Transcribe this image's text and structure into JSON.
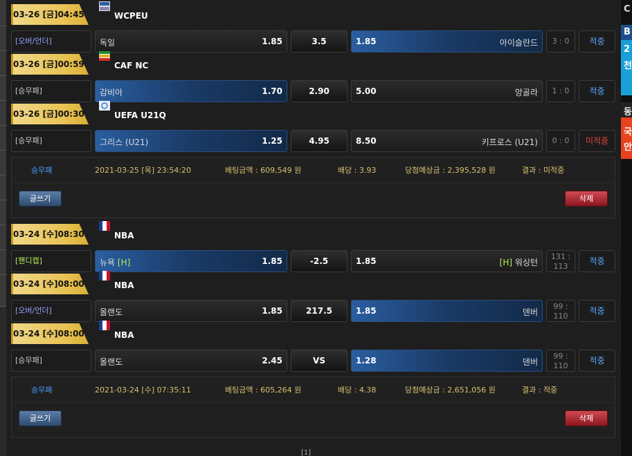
{
  "slips": [
    {
      "matches": [
        {
          "time": "03-26 [금]04:45",
          "league": "WCPEU",
          "icon": "wcpeu-league-icon",
          "type": "[오버/언더]",
          "type_style": "ou",
          "home": "독일",
          "home_odds": "1.85",
          "mid": "3.5",
          "away_odds": "1.85",
          "away": "아이슬란드",
          "home_tag": "",
          "away_tag": "",
          "score": "3 : 0",
          "score_lines": [
            "3 : 0"
          ],
          "result": "적중",
          "selected": "away"
        },
        {
          "time": "03-26 [금]00:59",
          "league": "CAF NC",
          "icon": "caf-league-icon",
          "type": "[승무패]",
          "type_style": "plain",
          "home": "감비아",
          "home_odds": "1.70",
          "mid": "2.90",
          "away_odds": "5.00",
          "away": "앙골라",
          "home_tag": "",
          "away_tag": "",
          "score": "1 : 0",
          "score_lines": [
            "1 : 0"
          ],
          "result": "적중",
          "selected": "home"
        },
        {
          "time": "03-26 [금]00:30",
          "league": "UEFA U21Q",
          "icon": "uefa-league-icon",
          "type": "[승무패]",
          "type_style": "plain",
          "home": "그리스 (U21)",
          "home_odds": "1.25",
          "mid": "4.95",
          "away_odds": "8.50",
          "away": "키프로스 (U21)",
          "home_tag": "",
          "away_tag": "",
          "score": "0 : 0",
          "score_lines": [
            "0 : 0"
          ],
          "result": "미적중",
          "selected": "home"
        }
      ],
      "summary": {
        "kind": "승무패",
        "date": "2021-03-25 [목] 23:54:20",
        "amount": "베팅금액 : 609,549 원",
        "odds": "배당 : 3.93",
        "expected": "당첨예상금 : 2,395,528 원",
        "result": "결과 : 미적중"
      },
      "write_label": "글쓰기",
      "delete_label": "삭제"
    },
    {
      "matches": [
        {
          "time": "03-24 [수]08:30",
          "league": "NBA",
          "icon": "nba-league-icon",
          "type": "[핸디캡]",
          "type_style": "hcap",
          "home": "뉴욕",
          "home_tag": "[H]",
          "home_odds": "1.85",
          "mid": "-2.5",
          "away_odds": "1.85",
          "away": "워싱턴",
          "away_tag": "[H]",
          "score": "131 : 113",
          "score_lines": [
            "131 :",
            "113"
          ],
          "result": "적중",
          "selected": "home"
        },
        {
          "time": "03-24 [수]08:00",
          "league": "NBA",
          "icon": "nba-league-icon",
          "type": "[오버/언더]",
          "type_style": "ou",
          "home": "올랜도",
          "home_odds": "1.85",
          "mid": "217.5",
          "away_odds": "1.85",
          "away": "덴버",
          "home_tag": "",
          "away_tag": "",
          "score": "99 : 110",
          "score_lines": [
            "99 :",
            "110"
          ],
          "result": "적중",
          "selected": "away"
        },
        {
          "time": "03-24 [수]08:00",
          "league": "NBA",
          "icon": "nba-league-icon",
          "type": "[승무패]",
          "type_style": "plain",
          "home": "올랜도",
          "home_odds": "2.45",
          "mid": "VS",
          "away_odds": "1.28",
          "away": "덴버",
          "home_tag": "",
          "away_tag": "",
          "score": "99 : 110",
          "score_lines": [
            "99 :",
            "110"
          ],
          "result": "적중",
          "selected": "away"
        }
      ],
      "summary": {
        "kind": "승무패",
        "date": "2021-03-24 [수] 07:35:11",
        "amount": "베팅금액 : 605,264 원",
        "odds": "배당 : 4.38",
        "expected": "당첨예상금 : 2,651,056 원",
        "result": "결과 : 적중"
      },
      "write_label": "글쓰기",
      "delete_label": "삭제"
    }
  ],
  "pager": "[1]",
  "right_strip": [
    "C",
    "B",
    "2",
    "천",
    "동",
    "국",
    "안"
  ],
  "colors": {
    "gold": "#e8c253",
    "blue_sel": "#2a5ea0",
    "win": "#5aa7ff",
    "lose": "#e0413b",
    "summary_text": "#d8c070"
  }
}
